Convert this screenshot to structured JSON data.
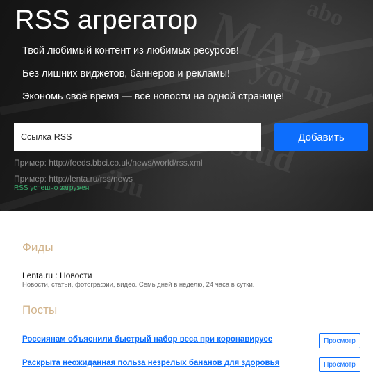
{
  "hero": {
    "title": "RSS агрегатор",
    "taglines": [
      "Твой любимый контент из любимых ресурсов!",
      "Без лишних виджетов, баннеров и рекламы!",
      "Экономь своё время — все новости на одной странице!"
    ],
    "form": {
      "input_placeholder": "Ссылка RSS",
      "input_value": "",
      "submit_label": "Добавить",
      "examples": [
        "Пример: http://feeds.bbci.co.uk/news/world/rss.xml",
        "Пример: http://lenta.ru/rss/news"
      ],
      "status": "RSS успешно загружен",
      "status_color": "#3cb371"
    },
    "accent_color": "#0d6efd"
  },
  "feeds": {
    "heading": "Фиды",
    "items": [
      {
        "title": "Lenta.ru : Новости",
        "description": "Новости, статьи, фотографии, видео. Семь дней в неделю, 24 часа в сутки."
      }
    ]
  },
  "posts": {
    "heading": "Посты",
    "items": [
      {
        "title": "Россиянам объяснили быстрый набор веса при коронавирусе",
        "button_label": "Просмотр"
      },
      {
        "title": "Раскрыта неожиданная польза незрелых бананов для здоровья",
        "button_label": "Просмотр"
      }
    ]
  }
}
